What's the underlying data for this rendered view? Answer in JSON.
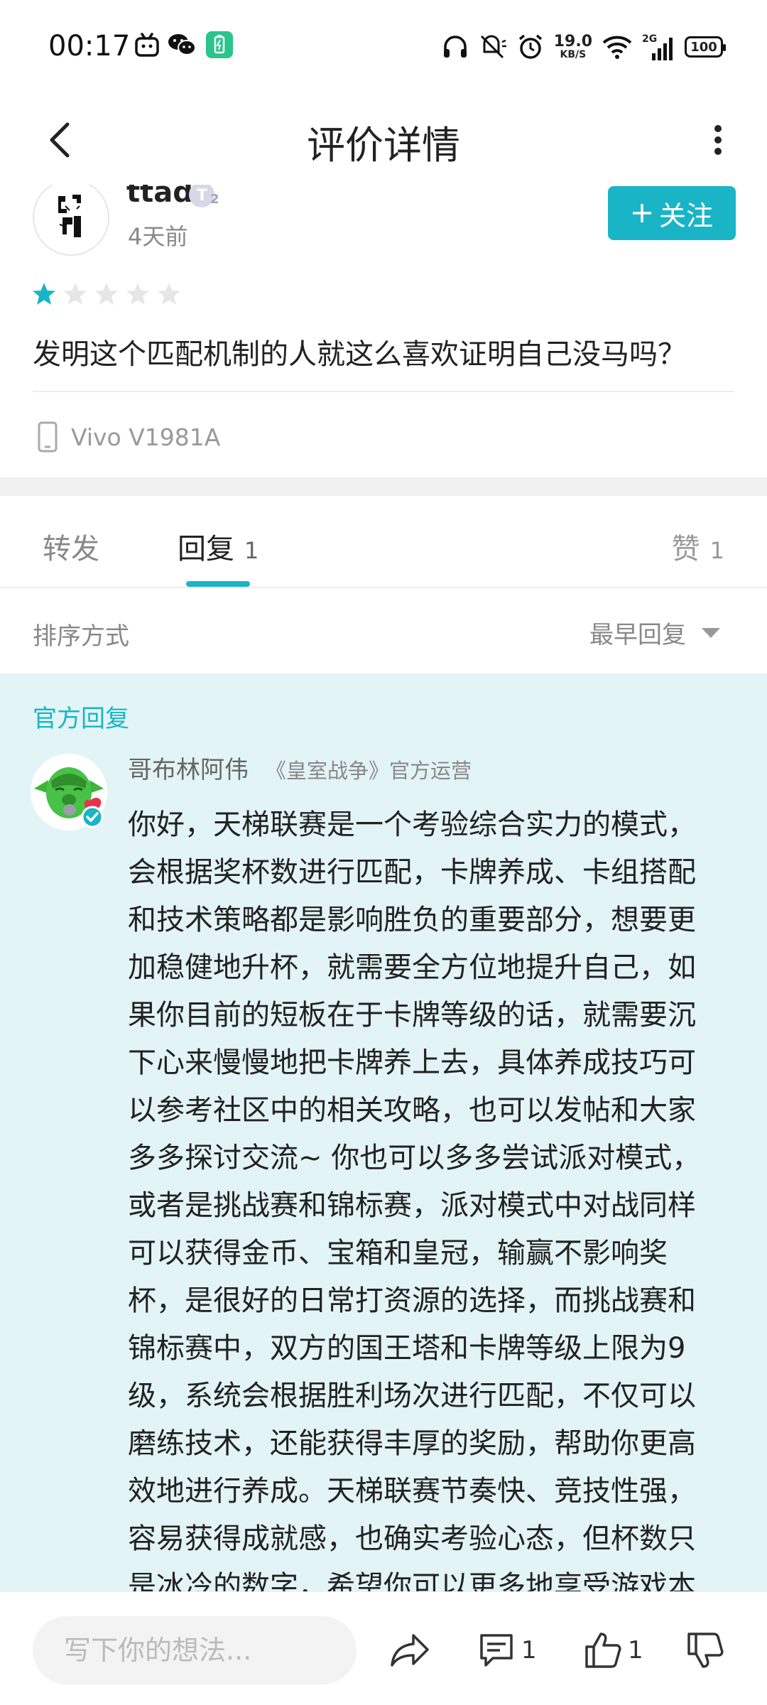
{
  "status_bar": {
    "time": "00:17",
    "net_speed": "19.0",
    "net_unit": "KB/S",
    "network": "2G",
    "battery": "100",
    "icons": [
      "tiktok-icon",
      "wechat-icon",
      "battery-app-icon",
      "headphone-icon",
      "mute-icon",
      "alarm-icon",
      "wifi-icon",
      "signal-icon"
    ]
  },
  "header": {
    "title": "评价详情"
  },
  "review": {
    "username": "ttad",
    "level_badge": "2",
    "time_ago": "4天前",
    "follow_label": "关注",
    "rating": 1,
    "rating_max": 5,
    "text": "发明这个匹配机制的人就这么喜欢证明自己没马吗？",
    "device": "Vivo V1981A"
  },
  "tabs": {
    "forward": "转发",
    "reply": "回复",
    "reply_count": "1",
    "like": "赞",
    "like_count": "1",
    "active": "reply"
  },
  "sort": {
    "label": "排序方式",
    "selected": "最早回复"
  },
  "official_reply": {
    "section_label": "官方回复",
    "name": "哥布林阿伟",
    "role": "《皇室战争》官方运营",
    "lines": [
      "你好，天梯联赛是一个考验综合实力的模式，",
      "会根据奖杯数进行匹配，卡牌养成、卡组搭配",
      "和技术策略都是影响胜负的重要部分，想要更",
      "加稳健地升杯，就需要全方位地提升自己，如",
      "果你目前的短板在于卡牌等级的话，就需要沉",
      "下心来慢慢地把卡牌养上去，具体养成技巧可",
      "以参考社区中的相关攻略，也可以发帖和大家",
      "多多探讨交流~ 你也可以多多尝试派对模式，",
      "或者是挑战赛和锦标赛，派对模式中对战同样",
      "可以获得金币、宝箱和皇冠，输赢不影响奖",
      "杯，是很好的日常打资源的选择，而挑战赛和",
      "锦标赛中，双方的国王塔和卡牌等级上限为9",
      "级，系统会根据胜利场次进行匹配，不仅可以",
      "磨练技术，还能获得丰厚的奖励，帮助你更高",
      "效地进行养成。天梯联赛节奏快、竞技性强，",
      "容易获得成就感，也确实考验心态，但杯数只",
      "是冰冷的数字，希望你可以更多地享受游戏本"
    ]
  },
  "bottom_bar": {
    "input_placeholder": "写下你的想法...",
    "comment_count": "1",
    "like_count": "1"
  },
  "colors": {
    "accent": "#19b5c6",
    "official_bg": "#e3f4f6"
  }
}
